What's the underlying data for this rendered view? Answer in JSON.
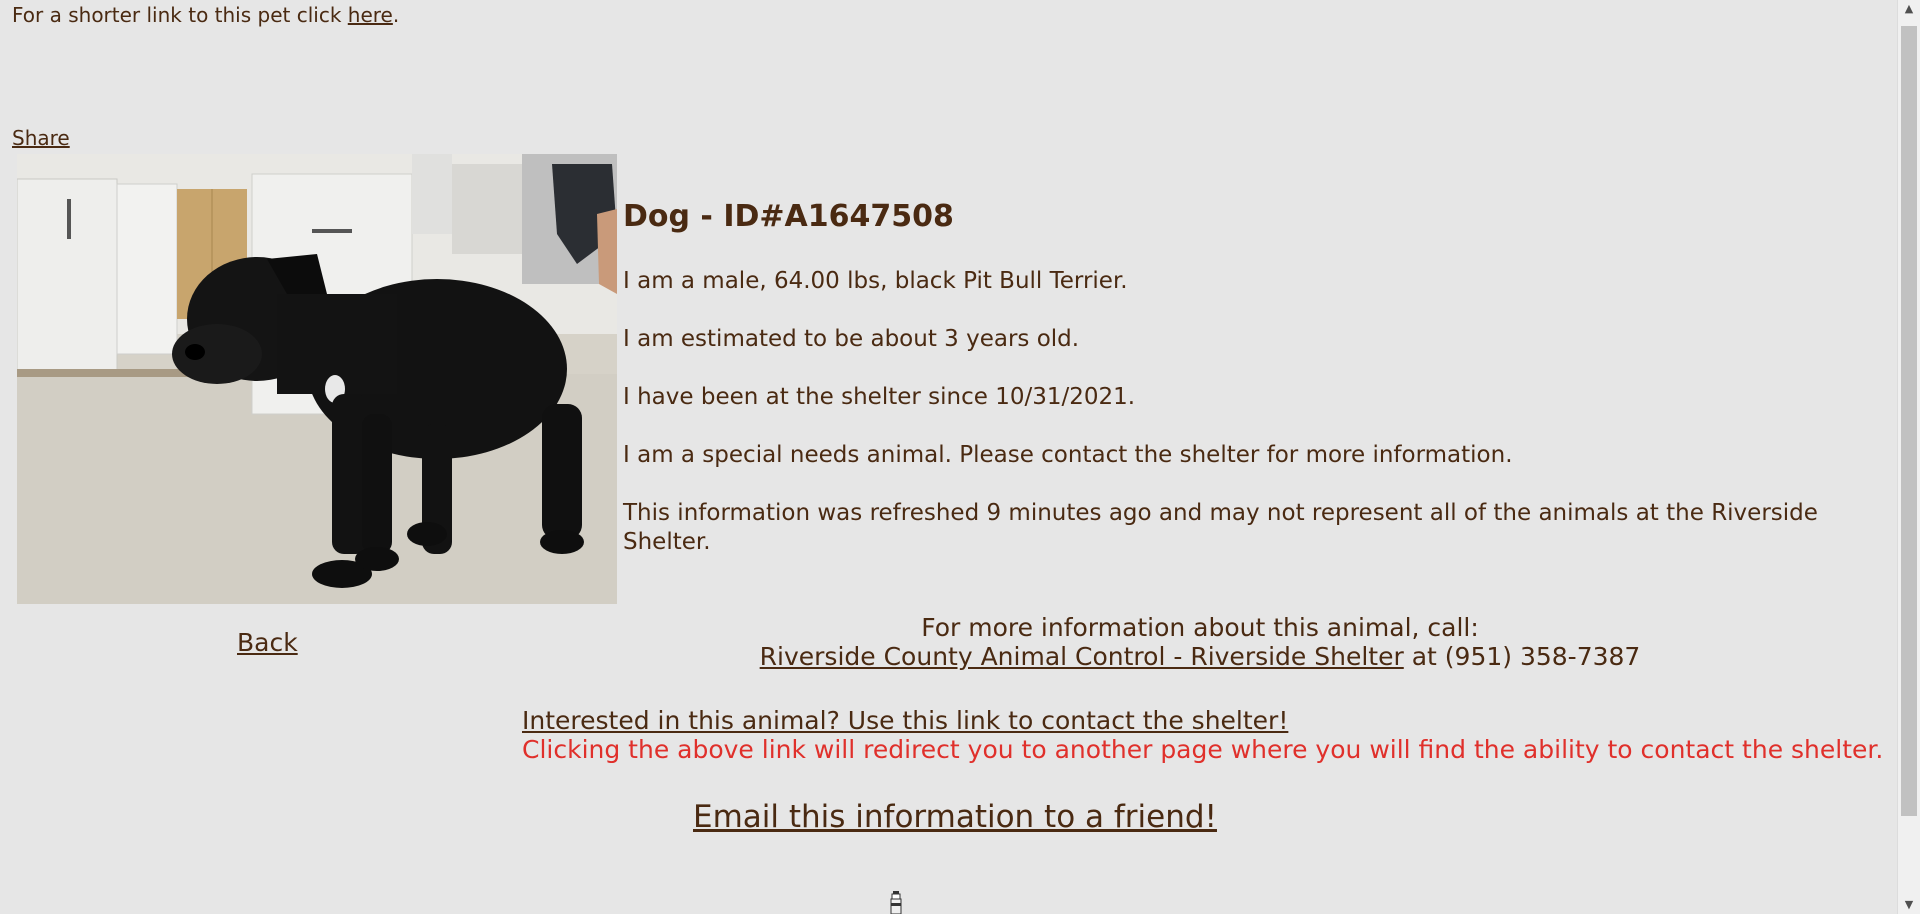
{
  "header": {
    "shorter_link_prefix": "For a shorter link to this pet click ",
    "shorter_link_text": "here",
    "shorter_link_suffix": "."
  },
  "share": {
    "label": "Share"
  },
  "photo": {
    "icon": "dog-photo"
  },
  "back": {
    "label": "Back"
  },
  "animal": {
    "title": "Dog - ID#A1647508",
    "description": "I am a male, 64.00 lbs, black Pit Bull Terrier.",
    "age": "I am estimated to be about 3 years old.",
    "since": "I have been at the shelter since 10/31/2021.",
    "special_needs": "I am a special needs animal. Please contact the shelter for more information.",
    "refreshed": "This information was refreshed 9 minutes ago and may not represent all of the animals at the Riverside Shelter."
  },
  "contact": {
    "heading": "For more information about this animal, call:",
    "shelter_link": "Riverside County Animal Control - Riverside Shelter",
    "phone_text": " at (951) 358-7387"
  },
  "interested": {
    "link": "Interested in this animal? Use this link to contact the shelter!",
    "note": "Clicking the above link will redirect you to another page where you will find the ability to contact the shelter."
  },
  "email": {
    "label": "Email this information to a friend!"
  },
  "colors": {
    "background": "#e6e6e6",
    "text": "#4a2a12",
    "warning": "#e0302b"
  }
}
